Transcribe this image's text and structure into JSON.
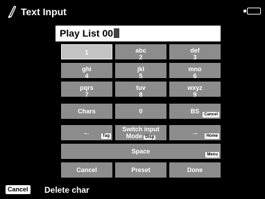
{
  "header": {
    "title": "Text Input",
    "pen_icon": "pen-icon",
    "battery_icon": "battery-icon"
  },
  "input": {
    "value": "Play List 00"
  },
  "keys": {
    "k1": {
      "line1": "1"
    },
    "abc": {
      "line1": "abc",
      "line2": "2"
    },
    "def": {
      "line1": "def",
      "line2": "3"
    },
    "ghi": {
      "line1": "ghi",
      "line2": "4"
    },
    "jkl": {
      "line1": "jkl",
      "line2": "5"
    },
    "mno": {
      "line1": "mno",
      "line2": "6"
    },
    "pqrs": {
      "line1": "pqrs",
      "line2": "7"
    },
    "tuv": {
      "line1": "tuv",
      "line2": "8"
    },
    "wxyz": {
      "line1": "wxyz",
      "line2": "9"
    },
    "chars": {
      "line1": "Chars"
    },
    "zero": {
      "line1": "0"
    },
    "bs": {
      "line1": "BS",
      "badge": "Cancel"
    },
    "left": {
      "line1": "←",
      "badge": "Tag"
    },
    "switch": {
      "line1": "Switch input",
      "line2": "Mode",
      "badge": "Disp"
    },
    "right": {
      "line1": "→",
      "badge": "Home"
    },
    "space": {
      "line1": "Space",
      "badge": "Menu"
    },
    "cancel": {
      "line1": "Cancel"
    },
    "preset": {
      "line1": "Preset"
    },
    "done": {
      "line1": "Done"
    }
  },
  "status": {
    "badge": "Cancel",
    "text": "Delete char"
  },
  "colors": {
    "background": "#000000",
    "key": "#8c8c8c",
    "key_selected": "#c3c3c3",
    "input_bg": "#ffffff"
  }
}
